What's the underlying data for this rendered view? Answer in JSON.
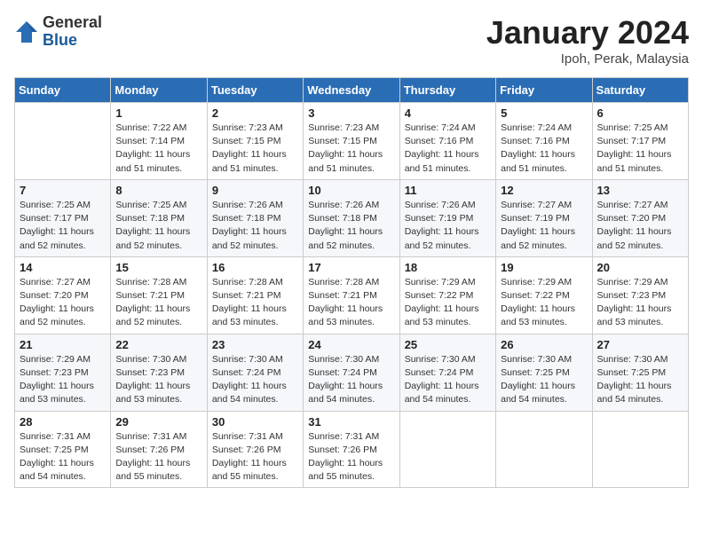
{
  "header": {
    "logo_general": "General",
    "logo_blue": "Blue",
    "month_title": "January 2024",
    "location": "Ipoh, Perak, Malaysia"
  },
  "days_of_week": [
    "Sunday",
    "Monday",
    "Tuesday",
    "Wednesday",
    "Thursday",
    "Friday",
    "Saturday"
  ],
  "weeks": [
    [
      {
        "day": "",
        "info": ""
      },
      {
        "day": "1",
        "info": "Sunrise: 7:22 AM\nSunset: 7:14 PM\nDaylight: 11 hours and 51 minutes."
      },
      {
        "day": "2",
        "info": "Sunrise: 7:23 AM\nSunset: 7:15 PM\nDaylight: 11 hours and 51 minutes."
      },
      {
        "day": "3",
        "info": "Sunrise: 7:23 AM\nSunset: 7:15 PM\nDaylight: 11 hours and 51 minutes."
      },
      {
        "day": "4",
        "info": "Sunrise: 7:24 AM\nSunset: 7:16 PM\nDaylight: 11 hours and 51 minutes."
      },
      {
        "day": "5",
        "info": "Sunrise: 7:24 AM\nSunset: 7:16 PM\nDaylight: 11 hours and 51 minutes."
      },
      {
        "day": "6",
        "info": "Sunrise: 7:25 AM\nSunset: 7:17 PM\nDaylight: 11 hours and 51 minutes."
      }
    ],
    [
      {
        "day": "7",
        "info": "Sunrise: 7:25 AM\nSunset: 7:17 PM\nDaylight: 11 hours and 52 minutes."
      },
      {
        "day": "8",
        "info": "Sunrise: 7:25 AM\nSunset: 7:18 PM\nDaylight: 11 hours and 52 minutes."
      },
      {
        "day": "9",
        "info": "Sunrise: 7:26 AM\nSunset: 7:18 PM\nDaylight: 11 hours and 52 minutes."
      },
      {
        "day": "10",
        "info": "Sunrise: 7:26 AM\nSunset: 7:18 PM\nDaylight: 11 hours and 52 minutes."
      },
      {
        "day": "11",
        "info": "Sunrise: 7:26 AM\nSunset: 7:19 PM\nDaylight: 11 hours and 52 minutes."
      },
      {
        "day": "12",
        "info": "Sunrise: 7:27 AM\nSunset: 7:19 PM\nDaylight: 11 hours and 52 minutes."
      },
      {
        "day": "13",
        "info": "Sunrise: 7:27 AM\nSunset: 7:20 PM\nDaylight: 11 hours and 52 minutes."
      }
    ],
    [
      {
        "day": "14",
        "info": "Sunrise: 7:27 AM\nSunset: 7:20 PM\nDaylight: 11 hours and 52 minutes."
      },
      {
        "day": "15",
        "info": "Sunrise: 7:28 AM\nSunset: 7:21 PM\nDaylight: 11 hours and 52 minutes."
      },
      {
        "day": "16",
        "info": "Sunrise: 7:28 AM\nSunset: 7:21 PM\nDaylight: 11 hours and 53 minutes."
      },
      {
        "day": "17",
        "info": "Sunrise: 7:28 AM\nSunset: 7:21 PM\nDaylight: 11 hours and 53 minutes."
      },
      {
        "day": "18",
        "info": "Sunrise: 7:29 AM\nSunset: 7:22 PM\nDaylight: 11 hours and 53 minutes."
      },
      {
        "day": "19",
        "info": "Sunrise: 7:29 AM\nSunset: 7:22 PM\nDaylight: 11 hours and 53 minutes."
      },
      {
        "day": "20",
        "info": "Sunrise: 7:29 AM\nSunset: 7:23 PM\nDaylight: 11 hours and 53 minutes."
      }
    ],
    [
      {
        "day": "21",
        "info": "Sunrise: 7:29 AM\nSunset: 7:23 PM\nDaylight: 11 hours and 53 minutes."
      },
      {
        "day": "22",
        "info": "Sunrise: 7:30 AM\nSunset: 7:23 PM\nDaylight: 11 hours and 53 minutes."
      },
      {
        "day": "23",
        "info": "Sunrise: 7:30 AM\nSunset: 7:24 PM\nDaylight: 11 hours and 54 minutes."
      },
      {
        "day": "24",
        "info": "Sunrise: 7:30 AM\nSunset: 7:24 PM\nDaylight: 11 hours and 54 minutes."
      },
      {
        "day": "25",
        "info": "Sunrise: 7:30 AM\nSunset: 7:24 PM\nDaylight: 11 hours and 54 minutes."
      },
      {
        "day": "26",
        "info": "Sunrise: 7:30 AM\nSunset: 7:25 PM\nDaylight: 11 hours and 54 minutes."
      },
      {
        "day": "27",
        "info": "Sunrise: 7:30 AM\nSunset: 7:25 PM\nDaylight: 11 hours and 54 minutes."
      }
    ],
    [
      {
        "day": "28",
        "info": "Sunrise: 7:31 AM\nSunset: 7:25 PM\nDaylight: 11 hours and 54 minutes."
      },
      {
        "day": "29",
        "info": "Sunrise: 7:31 AM\nSunset: 7:26 PM\nDaylight: 11 hours and 55 minutes."
      },
      {
        "day": "30",
        "info": "Sunrise: 7:31 AM\nSunset: 7:26 PM\nDaylight: 11 hours and 55 minutes."
      },
      {
        "day": "31",
        "info": "Sunrise: 7:31 AM\nSunset: 7:26 PM\nDaylight: 11 hours and 55 minutes."
      },
      {
        "day": "",
        "info": ""
      },
      {
        "day": "",
        "info": ""
      },
      {
        "day": "",
        "info": ""
      }
    ]
  ]
}
